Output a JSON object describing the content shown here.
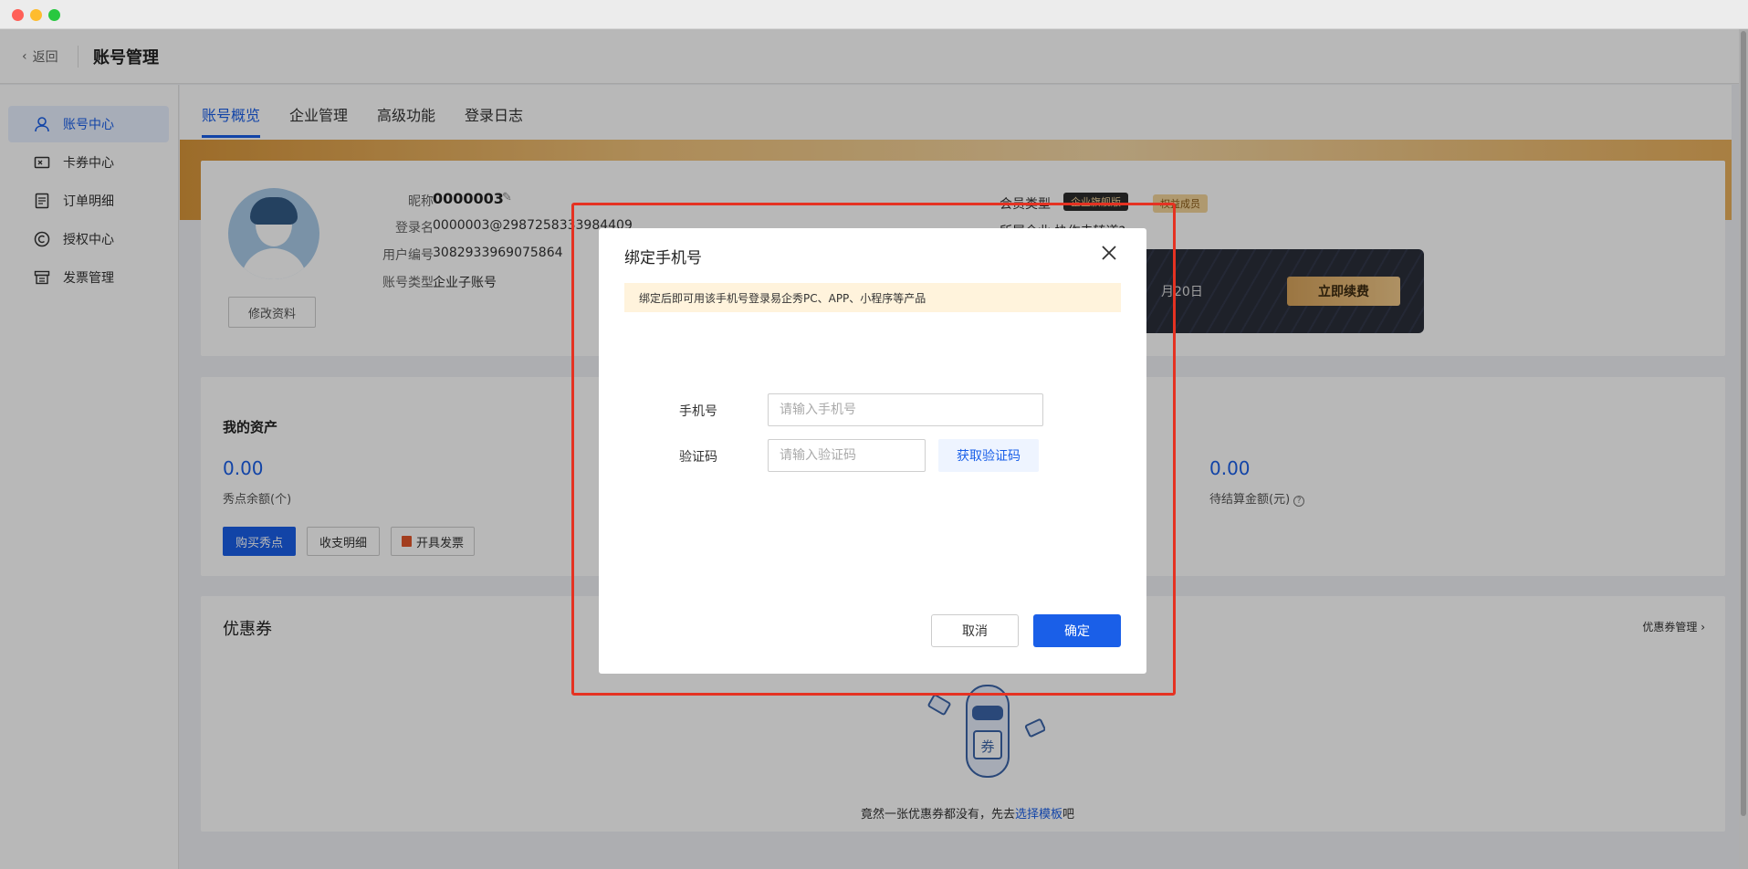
{
  "header": {
    "back_label": "返回",
    "title": "账号管理"
  },
  "sidebar": {
    "items": [
      {
        "label": "账号中心",
        "icon": "user-icon"
      },
      {
        "label": "卡券中心",
        "icon": "ticket-icon"
      },
      {
        "label": "订单明细",
        "icon": "document-icon"
      },
      {
        "label": "授权中心",
        "icon": "copyright-icon"
      },
      {
        "label": "发票管理",
        "icon": "invoice-icon"
      }
    ]
  },
  "tabs": [
    "账号概览",
    "企业管理",
    "高级功能",
    "登录日志"
  ],
  "profile": {
    "edit_label": "修改资料",
    "nickname_label": "昵称",
    "nickname": "0000003",
    "login_label": "登录名",
    "login_name": "0000003@2987258333984409",
    "user_id_label": "用户编号",
    "user_id": "3082933969075864",
    "account_type_label": "账号类型",
    "account_type": "企业子账号",
    "member_type_label": "会员类型",
    "member_badge": "企业旗舰版",
    "rights_badge": "权益成员",
    "company_partial": "所属企业  协作未转道?",
    "vip_date_partial": "月20日",
    "renew_label": "立即续费"
  },
  "assets": {
    "title": "我的资产",
    "balance_value": "0.00",
    "balance_label": "秀点余额(个)",
    "pending_value": "0.00",
    "pending_label": "待结算金额(元)",
    "buy_label": "购买秀点",
    "detail_label": "收支明细",
    "invoice_label": "开具发票"
  },
  "coupons": {
    "title": "优惠券",
    "manage_label": "优惠券管理",
    "mascot_text": "券",
    "empty_prefix": "竟然一张优惠券都没有，先去",
    "empty_link": "选择模板",
    "empty_suffix": "吧"
  },
  "modal": {
    "title": "绑定手机号",
    "notice": "绑定后即可用该手机号登录易企秀PC、APP、小程序等产品",
    "phone_label": "手机号",
    "phone_placeholder": "请输入手机号",
    "code_label": "验证码",
    "code_placeholder": "请输入验证码",
    "get_code_label": "获取验证码",
    "cancel_label": "取消",
    "confirm_label": "确定"
  },
  "colors": {
    "accent": "#1a5fe8",
    "highlight": "#e53222",
    "notice_bg": "#fff3dc"
  }
}
